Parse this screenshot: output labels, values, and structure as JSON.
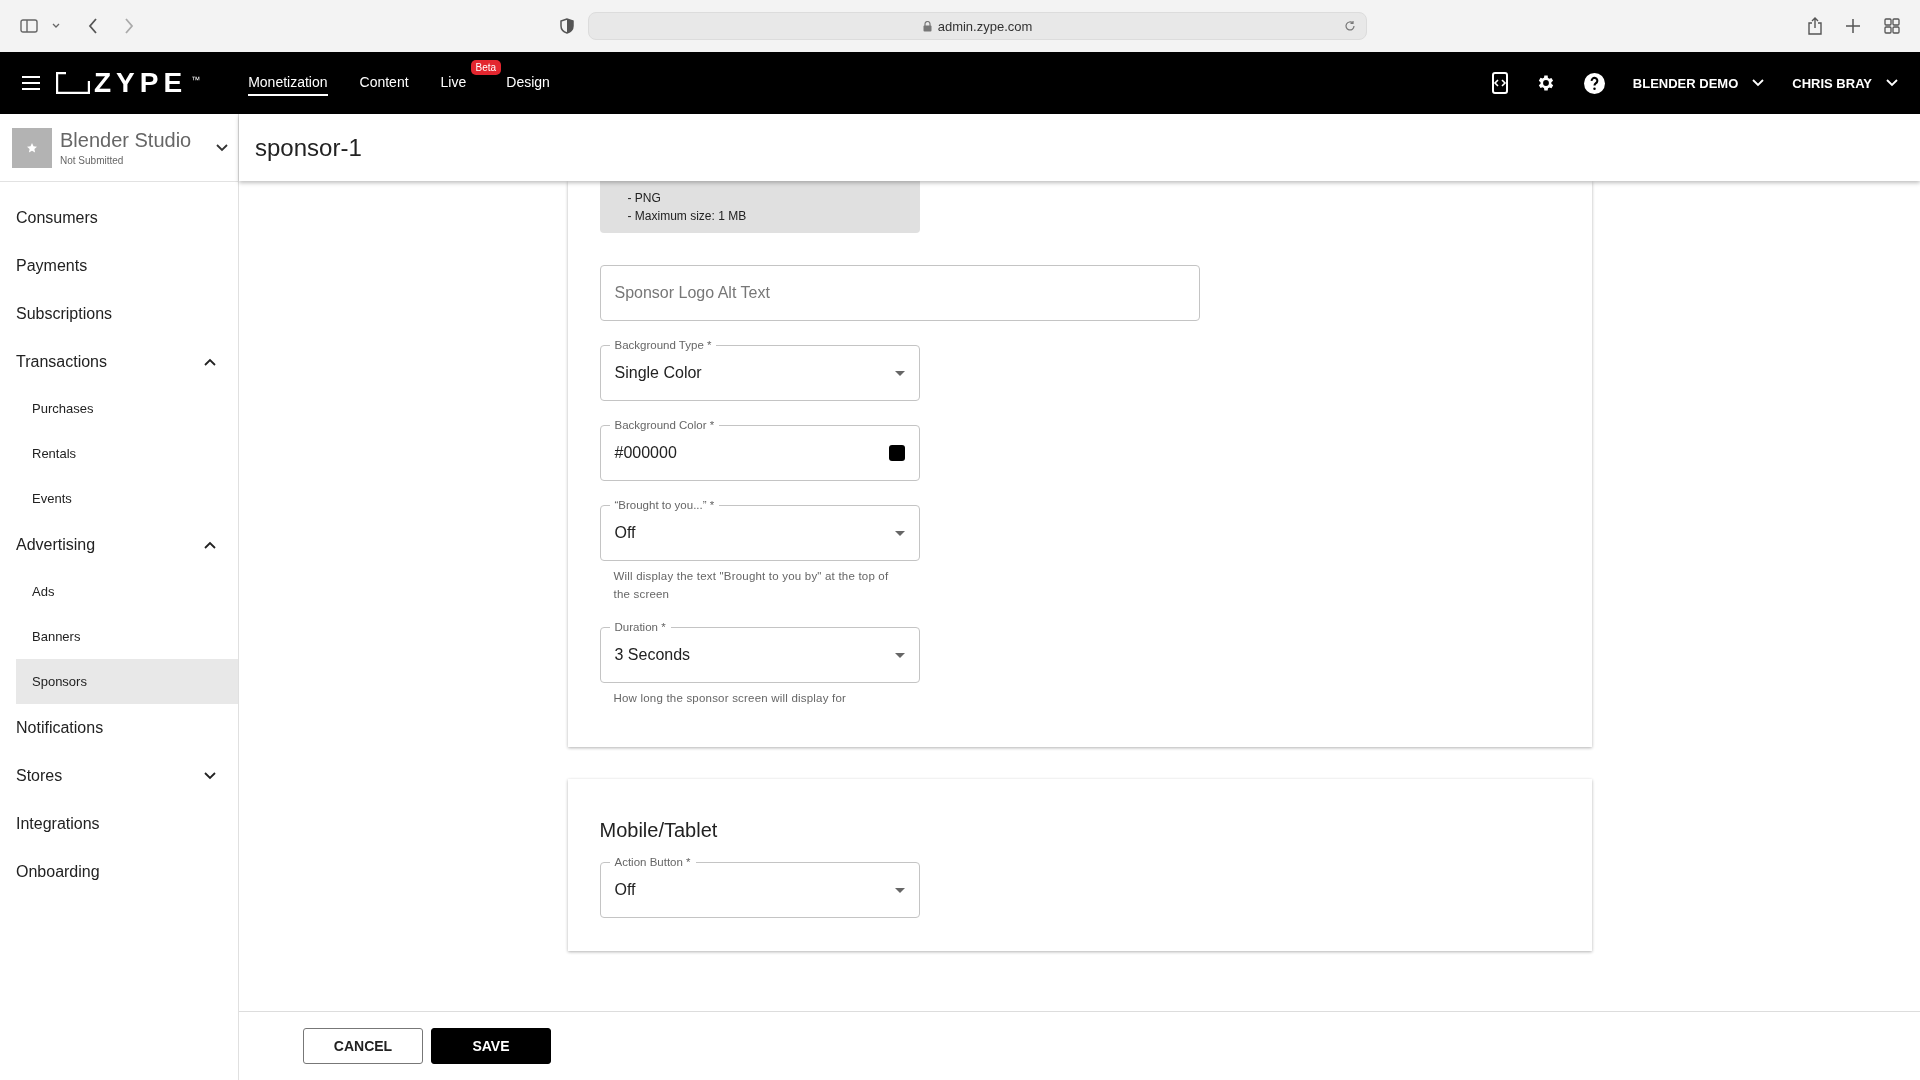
{
  "browser": {
    "url": "admin.zype.com"
  },
  "nav": {
    "items": [
      {
        "label": "Monetization",
        "selected": true
      },
      {
        "label": "Content",
        "selected": false
      },
      {
        "label": "Live",
        "selected": false,
        "badge": "Beta"
      },
      {
        "label": "Design",
        "selected": false
      }
    ],
    "logo": "ZYPE",
    "logo_mark": "™",
    "account": "BLENDER DEMO",
    "user": "CHRIS BRAY"
  },
  "sidebar": {
    "app": {
      "name": "Blender Studio",
      "status": "Not Submitted"
    },
    "items": [
      {
        "label": "Consumers",
        "selected": false
      },
      {
        "label": "Payments",
        "selected": false
      },
      {
        "label": "Subscriptions",
        "selected": false
      },
      {
        "label": "Transactions",
        "selected": false,
        "expanded": true,
        "children": [
          {
            "label": "Purchases",
            "selected": false
          },
          {
            "label": "Rentals",
            "selected": false
          },
          {
            "label": "Events",
            "selected": false
          }
        ]
      },
      {
        "label": "Advertising",
        "selected": false,
        "expanded": true,
        "children": [
          {
            "label": "Ads",
            "selected": false
          },
          {
            "label": "Banners",
            "selected": false
          },
          {
            "label": "Sponsors",
            "selected": true
          }
        ]
      },
      {
        "label": "Notifications",
        "selected": false
      },
      {
        "label": "Stores",
        "selected": false,
        "expanded": false
      },
      {
        "label": "Integrations",
        "selected": false
      },
      {
        "label": "Onboarding",
        "selected": false
      }
    ]
  },
  "page": {
    "title": "sponsor-1"
  },
  "sections": [
    {
      "requirements": [
        "- PNG",
        "- Maximum size: 1 MB"
      ],
      "fields": [
        {
          "kind": "text",
          "placeholder": "Sponsor Logo Alt Text"
        },
        {
          "kind": "select",
          "label": "Background Type *",
          "value": "Single Color"
        },
        {
          "kind": "color",
          "label": "Background Color *",
          "value": "#000000",
          "color": "#000000"
        },
        {
          "kind": "select",
          "label": "“Brought to you...” *",
          "value": "Off",
          "help": "Will display the text \"Brought to you by\" at the top of the screen"
        },
        {
          "kind": "select",
          "label": "Duration *",
          "value": "3 Seconds",
          "help": "How long the sponsor screen will display for"
        }
      ]
    },
    {
      "heading": "Mobile/Tablet",
      "fields": [
        {
          "kind": "select",
          "label": "Action Button *",
          "value": "Off"
        }
      ]
    }
  ],
  "buttons": [
    {
      "kind": "secondary",
      "label": "CANCEL"
    },
    {
      "kind": "primary",
      "label": "SAVE"
    }
  ]
}
